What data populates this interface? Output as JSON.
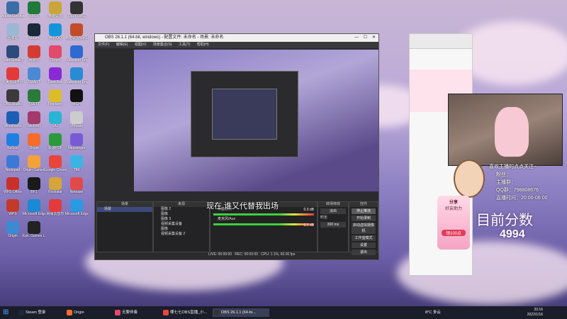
{
  "desktop_icons": [
    {
      "label": "AdobeSanctions",
      "color": "#3a6ea5"
    },
    {
      "label": "XBOX",
      "color": "#1f7a3b"
    },
    {
      "label": "英雄联盟",
      "color": "#c9a53a"
    },
    {
      "label": "OLLY DBG",
      "color": "#333"
    },
    {
      "label": "回收站",
      "color": "#9bb7d4"
    },
    {
      "label": "Steam",
      "color": "#1b2838"
    },
    {
      "label": "腾讯QQ",
      "color": "#1296db"
    },
    {
      "label": "英雄联盟WeGame",
      "color": "#c24c2a"
    },
    {
      "label": "TeamSpeak3",
      "color": "#2e4a7a"
    },
    {
      "label": "网易云",
      "color": "#d43c33"
    },
    {
      "label": "iTunes",
      "color": "#e24a6a"
    },
    {
      "label": "Wallpaper Engine",
      "color": "#2d6bd1"
    },
    {
      "label": "完美对战平台",
      "color": "#e23a3a"
    },
    {
      "label": "SMART",
      "color": "#4a8ad4"
    },
    {
      "label": "GeekBox",
      "color": "#8a2ad4"
    },
    {
      "label": "Wallpaper Engine",
      "color": "#2a8ad4"
    },
    {
      "label": "OBS Studio",
      "color": "#3a3a3a"
    },
    {
      "label": "TSETT",
      "color": "#2a7a3a"
    },
    {
      "label": "Potplayer",
      "color": "#dbbd2a"
    },
    {
      "label": "MCH",
      "color": "#111"
    },
    {
      "label": "Wiresharks",
      "color": "#1a5fb4"
    },
    {
      "label": "WinRAR",
      "color": "#a33a6a"
    },
    {
      "label": "UU",
      "color": "#2ab4d4"
    },
    {
      "label": "VMware",
      "color": "#ccc"
    },
    {
      "label": "KuGou",
      "color": "#1e7fe0"
    },
    {
      "label": "Origin",
      "color": "#f56c2d"
    },
    {
      "label": "极速PDF",
      "color": "#2a9a3a"
    },
    {
      "label": "Messenger",
      "color": "#7a5ad4"
    },
    {
      "label": "Nodepad",
      "color": "#3a7ad4"
    },
    {
      "label": "Origin Games",
      "color": "#f4a13a"
    },
    {
      "label": "Google Chrome",
      "color": "#e8453c"
    },
    {
      "label": "TIM",
      "color": "#3ab4e4"
    },
    {
      "label": "WPS Office",
      "color": "#c9302c"
    },
    {
      "label": "BF1",
      "color": "#1a1a1a"
    },
    {
      "label": "Rockstar",
      "color": "#d4a53a"
    },
    {
      "label": "Netease",
      "color": "#e24a4a"
    },
    {
      "label": "WPS",
      "color": "#c43a2a"
    },
    {
      "label": "Microsoft Edge",
      "color": "#1a8ad4"
    },
    {
      "label": "网易云音乐",
      "color": "#e33b3b"
    },
    {
      "label": "Microsoft Edge",
      "color": "#2a9ae4"
    },
    {
      "label": "Origin",
      "color": "#3a8ad4"
    },
    {
      "label": "Epic Games Launcher",
      "color": "#222"
    }
  ],
  "obs": {
    "title": "OBS 26.1.1 (64-bit, windows) - 配置文件: 未命名 - 场景: 未命名",
    "menu": [
      "文件(F)",
      "编辑(E)",
      "视图(V)",
      "场景集合(S)",
      "工具(T)",
      "帮助(H)"
    ],
    "docks": {
      "scenes": "场景",
      "sources": "来源",
      "mixer": "混音器",
      "transitions": "转场特效",
      "controls": "控件"
    },
    "scene_item": "场景",
    "sources": [
      "图像 2",
      "图像",
      "图像 3",
      "视频采集设备",
      "图像",
      "视频采集设备 2"
    ],
    "mixer_rows": [
      {
        "label": "桌面音频",
        "db": "0.0 dB"
      },
      {
        "label": "麦克风/Aux",
        "db": "0.0 dB"
      }
    ],
    "transition": "淡出",
    "duration_label": "时长",
    "duration": "300 ms",
    "controls": [
      "停止推流",
      "开始录制",
      "启动虚拟摄像机",
      "工作室模式",
      "设置",
      "退出"
    ],
    "status": {
      "live": "LIVE: 00:00:00",
      "rec": "REC: 00:00:00",
      "cpu": "CPU: 1.1%, 60.00 fps"
    }
  },
  "overlay": {
    "subtitle": "现在 谁又代替我出场",
    "info_lines": [
      "喜欢主播的点点关注~",
      "粉丝：",
      "主播群：",
      "QQ群：798808676",
      "直播时间：20:00-06:00"
    ],
    "score_label": "目前分数",
    "score": "4994",
    "share_title": "分享",
    "share_sub": "好友助力",
    "share_btn": "领100点"
  },
  "taskbar": {
    "items": [
      "Steam 登录",
      "Origin",
      "无聊伴奏",
      "哪七七OBS直播_小...",
      "OBS 26.1.1 (64-bi..."
    ],
    "time": "20:16",
    "date": "2022/1/16",
    "weather": "8°C 多云"
  }
}
